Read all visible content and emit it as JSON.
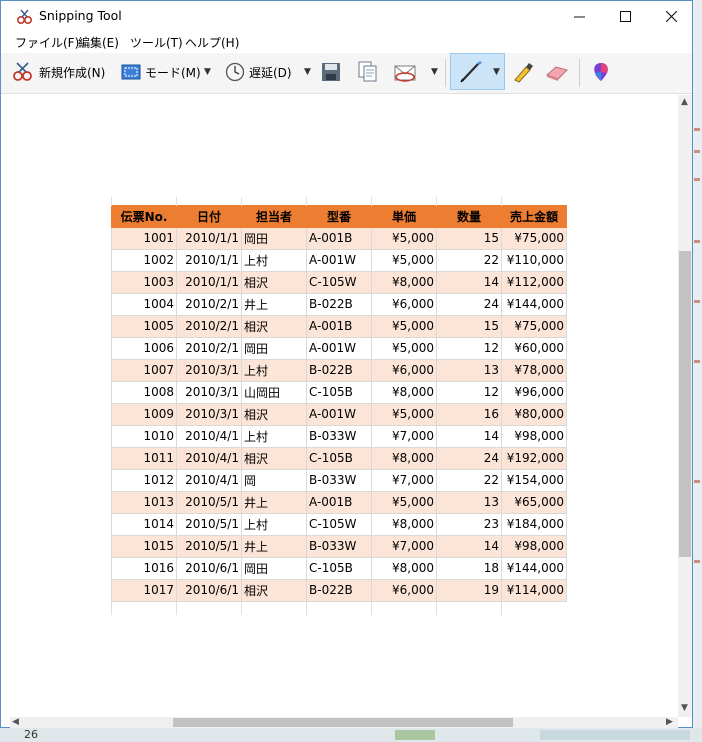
{
  "window": {
    "title": "Snipping Tool"
  },
  "menu": [
    "ファイル(F)",
    "編集(E)",
    "ツール(T)",
    "ヘルプ(H)"
  ],
  "toolbar": {
    "new_label": "新規作成(N)",
    "mode_label": "モード(M)",
    "delay_label": "遅延(D)"
  },
  "sheet": {
    "headers": [
      "伝票No.",
      "日付",
      "担当者",
      "型番",
      "単価",
      "数量",
      "売上金額"
    ],
    "rows": [
      [
        "1001",
        "2010/1/1",
        "岡田",
        "A-001B",
        "¥5,000",
        "15",
        "¥75,000"
      ],
      [
        "1002",
        "2010/1/1",
        "上村",
        "A-001W",
        "¥5,000",
        "22",
        "¥110,000"
      ],
      [
        "1003",
        "2010/1/1",
        "相沢",
        "C-105W",
        "¥8,000",
        "14",
        "¥112,000"
      ],
      [
        "1004",
        "2010/2/1",
        "井上",
        "B-022B",
        "¥6,000",
        "24",
        "¥144,000"
      ],
      [
        "1005",
        "2010/2/1",
        "相沢",
        "A-001B",
        "¥5,000",
        "15",
        "¥75,000"
      ],
      [
        "1006",
        "2010/2/1",
        "岡田",
        "A-001W",
        "¥5,000",
        "12",
        "¥60,000"
      ],
      [
        "1007",
        "2010/3/1",
        "上村",
        "B-022B",
        "¥6,000",
        "13",
        "¥78,000"
      ],
      [
        "1008",
        "2010/3/1",
        "山岡田",
        "C-105B",
        "¥8,000",
        "12",
        "¥96,000"
      ],
      [
        "1009",
        "2010/3/1",
        "相沢",
        "A-001W",
        "¥5,000",
        "16",
        "¥80,000"
      ],
      [
        "1010",
        "2010/4/1",
        "上村",
        "B-033W",
        "¥7,000",
        "14",
        "¥98,000"
      ],
      [
        "1011",
        "2010/4/1",
        "相沢",
        "C-105B",
        "¥8,000",
        "24",
        "¥192,000"
      ],
      [
        "1012",
        "2010/4/1",
        "岡",
        "B-033W",
        "¥7,000",
        "22",
        "¥154,000"
      ],
      [
        "1013",
        "2010/5/1",
        "井上",
        "A-001B",
        "¥5,000",
        "13",
        "¥65,000"
      ],
      [
        "1014",
        "2010/5/1",
        "上村",
        "C-105W",
        "¥8,000",
        "23",
        "¥184,000"
      ],
      [
        "1015",
        "2010/5/1",
        "井上",
        "B-033W",
        "¥7,000",
        "14",
        "¥98,000"
      ],
      [
        "1016",
        "2010/6/1",
        "岡田",
        "C-105B",
        "¥8,000",
        "18",
        "¥144,000"
      ],
      [
        "1017",
        "2010/6/1",
        "相沢",
        "B-022B",
        "¥6,000",
        "19",
        "¥114,000"
      ]
    ]
  },
  "desktop": {
    "corner_number": "26"
  },
  "colors": {
    "header": "#ed7d31",
    "band": "#fce4d6",
    "accent": "#5a8fc8"
  }
}
